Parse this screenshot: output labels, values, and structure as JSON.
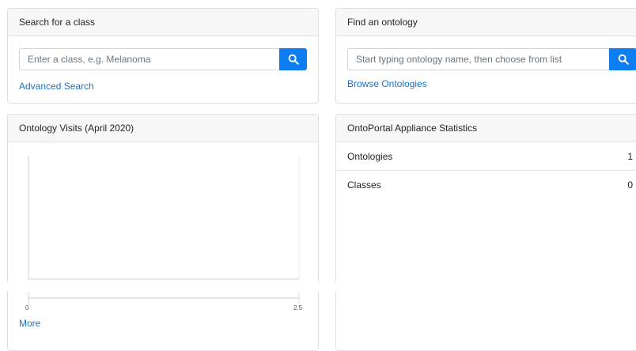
{
  "search_class": {
    "header": "Search for a class",
    "placeholder": "Enter a class, e.g. Melanoma",
    "advanced_link": "Advanced Search",
    "button_icon": "search-icon"
  },
  "find_ontology": {
    "header": "Find an ontology",
    "placeholder": "Start typing ontology name, then choose from list",
    "browse_link": "Browse Ontologies",
    "button_icon": "search-icon"
  },
  "visits": {
    "header": "Ontology Visits (April 2020)",
    "chart_data": {
      "type": "bar",
      "title": "",
      "xlabel": "",
      "ylabel": "",
      "xlim": [
        0,
        2.5
      ],
      "tick_labels": [
        "0",
        "2.5"
      ],
      "series": []
    },
    "more_link": "More"
  },
  "stats": {
    "header": "OntoPortal Appliance Statistics",
    "rows": [
      {
        "label": "Ontologies",
        "value": "1"
      },
      {
        "label": "Classes",
        "value": "0"
      }
    ]
  },
  "colors": {
    "accent": "#0d7ef2",
    "link": "#1a73c6",
    "header_bg": "#f7f7f7",
    "border": "#dfdfdf"
  }
}
